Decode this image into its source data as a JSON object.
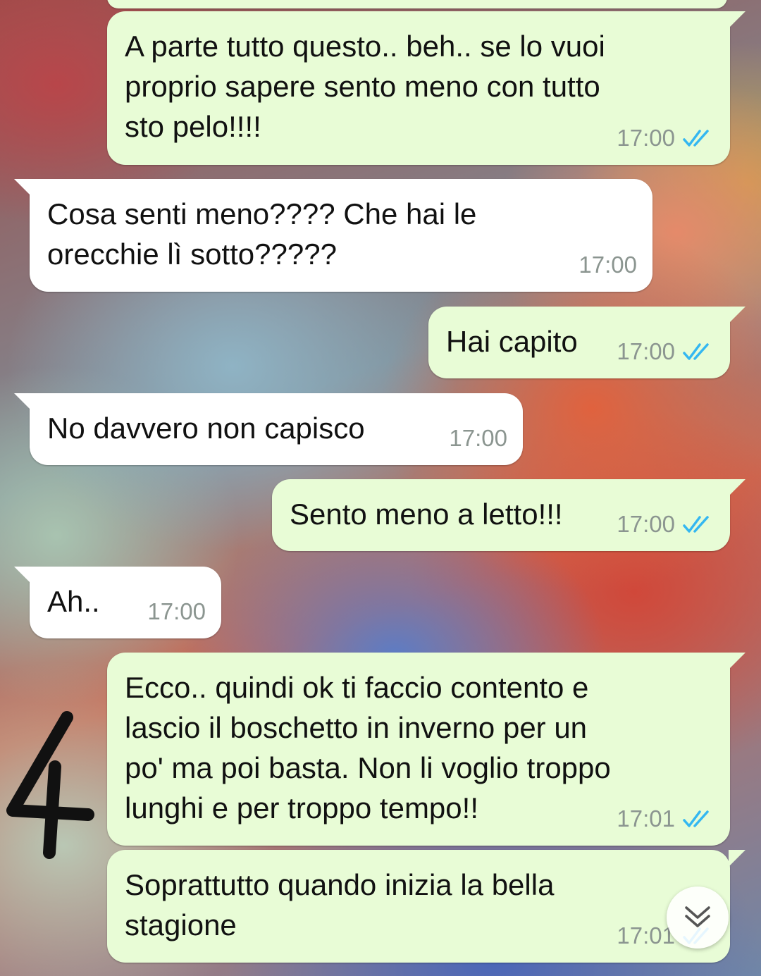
{
  "messages": [
    {
      "direction": "out",
      "text": "A parte tutto questo.. beh.. se lo vuoi\nproprio sapere sento meno con tutto\nsto pelo!!!!",
      "time": "17:00",
      "read": true
    },
    {
      "direction": "in",
      "text": "Cosa senti meno???? Che hai le\norecchie lì sotto?????",
      "time": "17:00"
    },
    {
      "direction": "out",
      "text": "Hai capito",
      "time": "17:00",
      "read": true
    },
    {
      "direction": "in",
      "text": "No davvero non capisco",
      "time": "17:00"
    },
    {
      "direction": "out",
      "text": "Sento meno a letto!!!",
      "time": "17:00",
      "read": true
    },
    {
      "direction": "in",
      "text": "Ah..",
      "time": "17:00"
    },
    {
      "direction": "out",
      "text": "Ecco.. quindi ok ti faccio contento e\nlascio il boschetto in inverno per un\npo' ma poi basta. Non li voglio troppo\nlunghi e per troppo tempo!!",
      "time": "17:01",
      "read": true
    },
    {
      "direction": "out",
      "text": "Soprattutto quando inizia la bella\nstagione",
      "time": "17:01",
      "read": true
    }
  ],
  "scroll_down_button": {
    "icon": "double-chevron-down-icon"
  },
  "handwritten_mark": "4",
  "colors": {
    "outgoing_bubble": "#e8fcd6",
    "incoming_bubble": "#ffffff",
    "read_ticks": "#34b7f1",
    "time_text": "#8b9590"
  }
}
